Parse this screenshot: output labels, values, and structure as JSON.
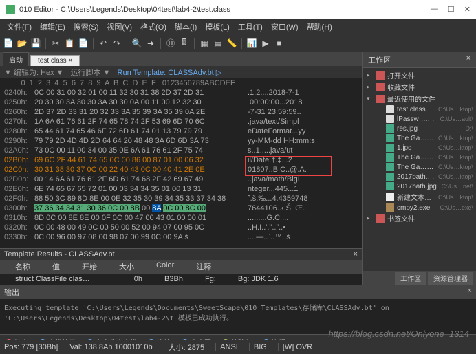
{
  "window": {
    "title": "010 Editor - C:\\Users\\Legends\\Desktop\\04test\\lab4-2\\test.class"
  },
  "menus": [
    "文件(F)",
    "编辑(E)",
    "搜索(S)",
    "视图(V)",
    "格式(O)",
    "脚本(I)",
    "模板(L)",
    "工具(T)",
    "窗口(W)",
    "帮助(H)"
  ],
  "tabs": {
    "start": "启动",
    "file": "test.class ×"
  },
  "info": {
    "edit": "▼ 编辑为: Hex ▼",
    "runas": "运行脚本 ▼",
    "run": "Run Template: CLASSAdv.bt ▷"
  },
  "hex": {
    "header": "        0  1  2  3  4  5  6  7  8  9  A  B  C  D  E  F   0123456789ABCDEF",
    "rows": [
      {
        "a": "0240h:",
        "b": "0C 00 31 00 32 01 00 11 32 30 31 38 2D 37 2D 31",
        "c": ".1.2....2018-7-1"
      },
      {
        "a": "0250h:",
        "b": "20 30 30 3A 30 30 3A 30 30 0A 00 11 00 12 32 30",
        "c": " 00:00:00...2018"
      },
      {
        "a": "0260h:",
        "b": "2D 37 2D 33 31 20 32 33 3A 35 39 3A 35 39 0A 2E",
        "c": "-7-31 23:59:59.."
      },
      {
        "a": "0270h:",
        "b": "1A 6A 61 76 61 2F 74 65 78 74 2F 53 69 6D 70 6C",
        "c": ".java/text/Simpl"
      },
      {
        "a": "0280h:",
        "b": "65 44 61 74 65 46 6F 72 6D 61 74 01 13 79 79 79",
        "c": "eDateFormat...yy"
      },
      {
        "a": "0290h:",
        "b": "79 79 2D 4D 4D 2D 64 64 20 48 48 3A 6D 6D 3A 73",
        "c": "yy-MM-dd HH:mm:s"
      },
      {
        "a": "02A0h:",
        "b": "73 0C 00 11 00 34 00 35 0E 6A 61 76 61 2F 75 74",
        "c": "s..1.....java/ut"
      },
      {
        "a": "02B0h:",
        "b": "69 6C 2F 44 61 74 65 0C 00 86 00 87 01 00 06 32",
        "c": "il/Date.†.‡...2",
        "hl": true
      },
      {
        "a": "02C0h:",
        "b": "30 31 38 30 37 0C 00 22 40 43 0C 00 40 41 2E 0E",
        "c": "01807..B.C..@.A.",
        "hl": true
      },
      {
        "a": "02D0h:",
        "b": "00 14 6A 61 76 61 2F 6D 61 74 68 2F 42 69 67 49",
        "c": "..java/math/BigI"
      },
      {
        "a": "02E0h:",
        "b": "6E 74 65 67 65 72 01 00 03 34 34 35 01 00 13 31",
        "c": "nteger...445...1"
      },
      {
        "a": "02F0h:",
        "b": "88 50 3C 89 8D 8E 00 0E 32 35 30 39 34 35 33 37 34 38",
        "c": "ˆ.š.‰...4.4359748"
      },
      {
        "a": "0300h:",
        "b": "37 36 34 34 31 30 36 0C 00 8B 00 8A 0C 00 8C 00",
        "c": "7644106..‹.Š..Œ.",
        "sel": true
      },
      {
        "a": "0310h:",
        "b": "8D 0C 00 8E 8E 00 0F 0C 00 47 00 43 01 00 00 01",
        "c": ".........G.C...."
      },
      {
        "a": "0320h:",
        "b": "0C 00 48 00 49 0C 00 50 00 52 00 94 07 00 95 0C",
        "c": "..H.I..'.\"..”..•"
      },
      {
        "a": "0330h:",
        "b": "0C 00 96 00 97 08 00 98 07 00 99 0C 00 9A š",
        "c": "....—..˜..™..š"
      }
    ]
  },
  "template": {
    "title": "Template Results - CLASSAdv.bt",
    "cols": [
      "名称",
      "值",
      "开始",
      "大小",
      "Color",
      "注释"
    ],
    "row": [
      "struct ClassFile clas…",
      "",
      "0h",
      "B3Bh",
      "Fg:",
      "Bg: JDK 1.6"
    ]
  },
  "workspace": {
    "title": "工作区",
    "items": [
      {
        "l": 1,
        "icon": "book",
        "name": "打开文件"
      },
      {
        "l": 1,
        "icon": "book",
        "name": "收藏文件"
      },
      {
        "l": 1,
        "icon": "book",
        "name": "最近使用的文件",
        "exp": true
      },
      {
        "l": 2,
        "icon": "file",
        "name": "test.class",
        "path": "C:\\Us…ktop\\"
      },
      {
        "l": 2,
        "icon": "file",
        "name": "lPassw….class",
        "path": "C:\\Us…ault\\"
      },
      {
        "l": 2,
        "icon": "img",
        "name": "res.jpg",
        "path": "D:\\"
      },
      {
        "l": 2,
        "icon": "img",
        "name": "The Ga…rs.jpg",
        "path": "C:\\Us…ktop\\"
      },
      {
        "l": 2,
        "icon": "img",
        "name": "1.jpg",
        "path": "C:\\Us…ktop\\"
      },
      {
        "l": 2,
        "icon": "img",
        "name": "The Ga…rs.jpg",
        "path": "C:\\Us…ktop\\"
      },
      {
        "l": 2,
        "icon": "img",
        "name": "The Ga…rs.png",
        "path": "C:\\Us…ktop\\"
      },
      {
        "l": 2,
        "icon": "img",
        "name": "2017bath.png",
        "path": "C:\\Us…ktop\\"
      },
      {
        "l": 2,
        "icon": "img",
        "name": "2017bath.jpg",
        "path": "C:\\Us…net\\"
      },
      {
        "l": 2,
        "icon": "txt",
        "name": "新建文本….txt",
        "path": "C:\\Us…ktop\\"
      },
      {
        "l": 2,
        "icon": "exe",
        "name": "cmpy2.exe",
        "path": "C:\\Us…exe\\"
      },
      {
        "l": 1,
        "icon": "book",
        "name": "书签文件"
      }
    ],
    "tabs": [
      "工作区",
      "资源管理器"
    ]
  },
  "output": {
    "title": "输出",
    "body": "Executing template 'C:\\Users\\Legends\\Documents\\SweetScape\\010 Templates\\存储库\\CLASSAdv.bt' on 'C:\\Users\\Legends\\Desktop\\04test\\lab4-2\\t\n模板已成功执行。"
  },
  "btmtabs": [
    "输出",
    "查找结果",
    "在文件中查找",
    "比较",
    "直方图",
    "校验和",
    "进程"
  ],
  "status": {
    "pos": "Pos: 779 [30Bh]",
    "val": "Val: 138 8Ah 10001010b",
    "size": "大小: 2875",
    "enc": "ANSI",
    "end": "BIG",
    "ovr": "[W] OVR"
  },
  "watermark": "https://blog.csdn.net/Onlyone_1314"
}
